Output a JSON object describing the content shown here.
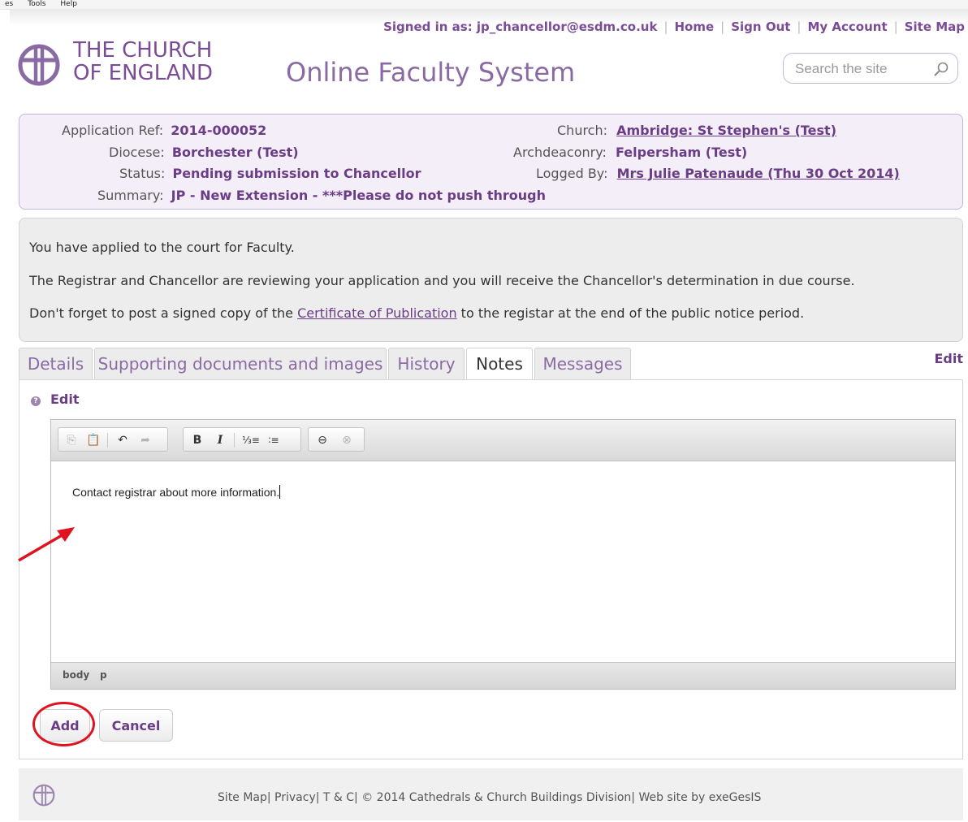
{
  "menubar": {
    "items": [
      "es",
      "Tools",
      "Help"
    ]
  },
  "top_links": {
    "signed_in": "Signed in as: jp_chancellor@esdm.co.uk",
    "home": "Home",
    "sign_out": "Sign Out",
    "my_account": "My Account",
    "site_map": "Site Map"
  },
  "logo": {
    "line1": "THE CHURCH",
    "line2": "OF ENGLAND"
  },
  "app_title": "Online Faculty System",
  "search": {
    "placeholder": "Search the site"
  },
  "application": {
    "ref_label": "Application Ref:",
    "ref_value": "2014-000052",
    "diocese_label": "Diocese:",
    "diocese_value": "Borchester (Test)",
    "status_label": "Status:",
    "status_value": "Pending submission to Chancellor",
    "summary_label": "Summary:",
    "summary_value": "JP - New Extension - ***Please do not push through",
    "church_label": "Church:",
    "church_value": "Ambridge: St Stephen's (Test)",
    "archdeaconry_label": "Archdeaconry:",
    "archdeaconry_value": "Felpersham (Test)",
    "logged_label": "Logged By:",
    "logged_value": "Mrs Julie Patenaude (Thu 30 Oct 2014)"
  },
  "notice": {
    "line1": "You have applied to the court for Faculty.",
    "line2": "The Registrar and Chancellor are reviewing your application and you will receive the Chancellor's determination in due course.",
    "line3_pre": "Don't forget to post a signed copy of the ",
    "line3_link": "Certificate of Publication",
    "line3_post": " to the registar at the end of the public notice period."
  },
  "tabs": [
    {
      "label": "Details"
    },
    {
      "label": "Supporting documents and images"
    },
    {
      "label": "History"
    },
    {
      "label": "Notes",
      "active": true
    },
    {
      "label": "Messages"
    }
  ],
  "tab_edit_link": "Edit",
  "edit_label": "Edit",
  "editor": {
    "content": "Contact registrar about more information.",
    "path": [
      "body",
      "p"
    ],
    "toolbar": [
      "copy",
      "paste",
      "undo",
      "redo",
      "bold",
      "italic",
      "numbered-list",
      "bulleted-list",
      "link",
      "unlink"
    ]
  },
  "buttons": {
    "add": "Add",
    "cancel": "Cancel"
  },
  "footer": {
    "text": "Site Map| Privacy| T & C| © 2014 Cathedrals & Church Buildings Division| Web site by exeGesIS"
  },
  "colors": {
    "brand": "#7b4c96",
    "annotation": "#e0121f"
  }
}
